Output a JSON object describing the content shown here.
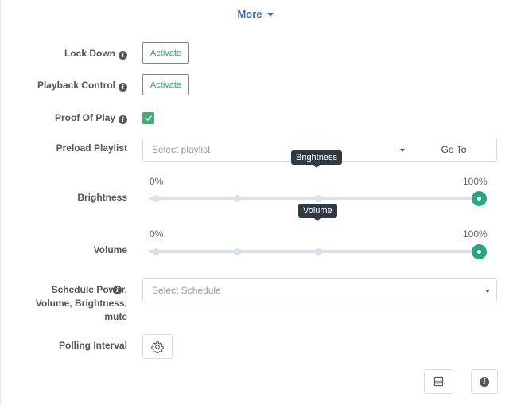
{
  "more": {
    "label": "More"
  },
  "rows": {
    "lock_down": {
      "label": "Lock Down",
      "button": "Activate"
    },
    "playback_control": {
      "label": "Playback Control",
      "button": "Activate"
    },
    "proof_of_play": {
      "label": "Proof Of Play",
      "checked": true
    },
    "preload_playlist": {
      "label": "Preload Playlist",
      "placeholder": "Select playlist",
      "goto": "Go To"
    },
    "brightness": {
      "label": "Brightness",
      "tooltip": "Brightness",
      "min_label": "0%",
      "max_label": "100%",
      "value_percent": 100
    },
    "volume": {
      "label": "Volume",
      "tooltip": "Volume",
      "min_label": "0%",
      "max_label": "100%",
      "value_percent": 100
    },
    "schedule": {
      "label": "Schedule Power, Volume, Brightness, mute",
      "placeholder": "Select Schedule"
    },
    "polling_interval": {
      "label": "Polling Interval"
    }
  },
  "icons": {
    "info": "info-icon",
    "check": "check-icon",
    "gear": "gear-icon",
    "list": "list-icon",
    "info_footer": "info-icon"
  },
  "colors": {
    "accent": "#25a882",
    "link": "#3a6ea5",
    "tooltip_bg": "#2f3a45",
    "track": "#d9e1ea"
  }
}
